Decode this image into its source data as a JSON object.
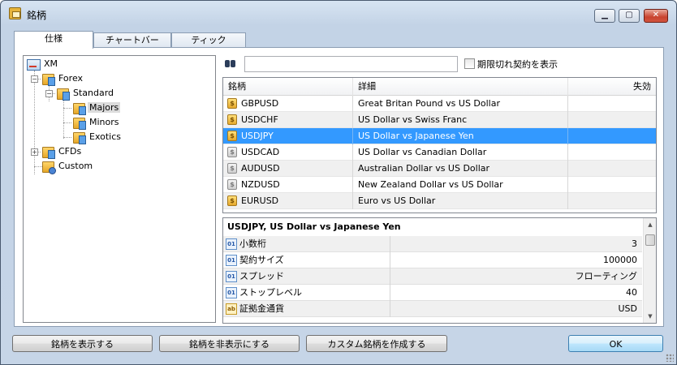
{
  "window": {
    "title": "銘柄",
    "min_glyph": "▁",
    "max_glyph": "▢",
    "close_glyph": "✕"
  },
  "tabs": [
    {
      "label": "仕様",
      "active": true
    },
    {
      "label": "チャートバー",
      "active": false
    },
    {
      "label": "ティック",
      "active": false
    }
  ],
  "tree": {
    "root": "XM",
    "forex": "Forex",
    "standard": "Standard",
    "majors": "Majors",
    "minors": "Minors",
    "exotics": "Exotics",
    "cfds": "CFDs",
    "custom": "Custom",
    "selected": "Majors"
  },
  "search": {
    "value": "",
    "placeholder": ""
  },
  "expired_checkbox": {
    "label": "期限切れ契約を表示",
    "checked": false
  },
  "symbol_table": {
    "headers": {
      "symbol": "銘柄",
      "detail": "詳細",
      "expiry": "失効"
    },
    "rows": [
      {
        "symbol": "GBPUSD",
        "detail": "Great Britan Pound vs US Dollar",
        "expiry": "",
        "icon": "gold"
      },
      {
        "symbol": "USDCHF",
        "detail": "US Dollar vs Swiss Franc",
        "expiry": "",
        "icon": "gold"
      },
      {
        "symbol": "USDJPY",
        "detail": "US Dollar vs Japanese Yen",
        "expiry": "",
        "icon": "gold",
        "selected": true
      },
      {
        "symbol": "USDCAD",
        "detail": "US Dollar vs Canadian Dollar",
        "expiry": "",
        "icon": "gray"
      },
      {
        "symbol": "AUDUSD",
        "detail": "Australian Dollar vs US Dollar",
        "expiry": "",
        "icon": "gray"
      },
      {
        "symbol": "NZDUSD",
        "detail": "New Zealand Dollar vs US Dollar",
        "expiry": "",
        "icon": "gray"
      },
      {
        "symbol": "EURUSD",
        "detail": "Euro vs US Dollar",
        "expiry": "",
        "icon": "gold"
      }
    ]
  },
  "properties": {
    "title": "USDJPY, US Dollar vs Japanese Yen",
    "rows": [
      {
        "name": "小数桁",
        "value": "3",
        "icon": "01"
      },
      {
        "name": "契約サイズ",
        "value": "100000",
        "icon": "01"
      },
      {
        "name": "スプレッド",
        "value": "フローティング",
        "icon": "01"
      },
      {
        "name": "ストップレベル",
        "value": "40",
        "icon": "01"
      },
      {
        "name": "証拠金通貨",
        "value": "USD",
        "icon": "ab"
      }
    ],
    "scroll_up": "▲",
    "scroll_down": "▼"
  },
  "buttons": {
    "show": "銘柄を表示する",
    "hide": "銘柄を非表示にする",
    "create_custom": "カスタム銘柄を作成する",
    "ok": "OK"
  },
  "icon_glyphs": {
    "symbol": "$",
    "expand_minus": "−",
    "expand_plus": "+"
  }
}
